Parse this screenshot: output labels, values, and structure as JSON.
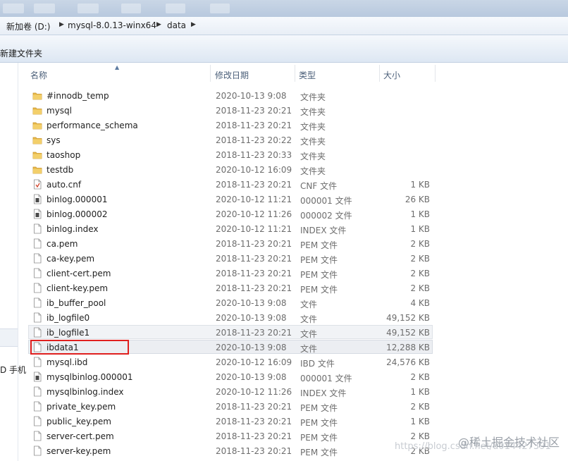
{
  "address": {
    "crumbs": [
      "新加卷 (D:)",
      "mysql-8.0.13-winx64",
      "data"
    ]
  },
  "toolbar": {
    "new_folder_label": "新建文件夹"
  },
  "left_pane": {
    "fragment_text": "D 手机"
  },
  "columns": {
    "name": "名称",
    "date": "修改日期",
    "type": "类型",
    "size": "大小"
  },
  "files": [
    {
      "name": "#innodb_temp",
      "date": "2020-10-13 9:08",
      "type": "文件夹",
      "size": "",
      "icon": "folder-icon"
    },
    {
      "name": "mysql",
      "date": "2018-11-23 20:21",
      "type": "文件夹",
      "size": "",
      "icon": "folder-icon"
    },
    {
      "name": "performance_schema",
      "date": "2018-11-23 20:21",
      "type": "文件夹",
      "size": "",
      "icon": "folder-icon"
    },
    {
      "name": "sys",
      "date": "2018-11-23 20:22",
      "type": "文件夹",
      "size": "",
      "icon": "folder-icon"
    },
    {
      "name": "taoshop",
      "date": "2018-11-23 20:33",
      "type": "文件夹",
      "size": "",
      "icon": "folder-icon"
    },
    {
      "name": "testdb",
      "date": "2020-10-12 16:09",
      "type": "文件夹",
      "size": "",
      "icon": "folder-icon"
    },
    {
      "name": "auto.cnf",
      "date": "2018-11-23 20:21",
      "type": "CNF 文件",
      "size": "1 KB",
      "icon": "config-file-icon"
    },
    {
      "name": "binlog.000001",
      "date": "2020-10-12 11:21",
      "type": "000001 文件",
      "size": "26 KB",
      "icon": "binary-file-icon"
    },
    {
      "name": "binlog.000002",
      "date": "2020-10-12 11:26",
      "type": "000002 文件",
      "size": "1 KB",
      "icon": "binary-file-icon"
    },
    {
      "name": "binlog.index",
      "date": "2020-10-12 11:21",
      "type": "INDEX 文件",
      "size": "1 KB",
      "icon": "file-icon"
    },
    {
      "name": "ca.pem",
      "date": "2018-11-23 20:21",
      "type": "PEM 文件",
      "size": "2 KB",
      "icon": "file-icon"
    },
    {
      "name": "ca-key.pem",
      "date": "2018-11-23 20:21",
      "type": "PEM 文件",
      "size": "2 KB",
      "icon": "file-icon"
    },
    {
      "name": "client-cert.pem",
      "date": "2018-11-23 20:21",
      "type": "PEM 文件",
      "size": "2 KB",
      "icon": "file-icon"
    },
    {
      "name": "client-key.pem",
      "date": "2018-11-23 20:21",
      "type": "PEM 文件",
      "size": "2 KB",
      "icon": "file-icon"
    },
    {
      "name": "ib_buffer_pool",
      "date": "2020-10-13 9:08",
      "type": "文件",
      "size": "4 KB",
      "icon": "file-icon"
    },
    {
      "name": "ib_logfile0",
      "date": "2020-10-13 9:08",
      "type": "文件",
      "size": "49,152 KB",
      "icon": "file-icon"
    },
    {
      "name": "ib_logfile1",
      "date": "2018-11-23 20:21",
      "type": "文件",
      "size": "49,152 KB",
      "icon": "file-icon"
    },
    {
      "name": "ibdata1",
      "date": "2020-10-13 9:08",
      "type": "文件",
      "size": "12,288 KB",
      "icon": "file-icon"
    },
    {
      "name": "mysql.ibd",
      "date": "2020-10-12 16:09",
      "type": "IBD 文件",
      "size": "24,576 KB",
      "icon": "file-icon"
    },
    {
      "name": "mysqlbinlog.000001",
      "date": "2020-10-13 9:08",
      "type": "000001 文件",
      "size": "2 KB",
      "icon": "binary-file-icon"
    },
    {
      "name": "mysqlbinlog.index",
      "date": "2020-10-12 11:26",
      "type": "INDEX 文件",
      "size": "1 KB",
      "icon": "file-icon"
    },
    {
      "name": "private_key.pem",
      "date": "2018-11-23 20:21",
      "type": "PEM 文件",
      "size": "2 KB",
      "icon": "file-icon"
    },
    {
      "name": "public_key.pem",
      "date": "2018-11-23 20:21",
      "type": "PEM 文件",
      "size": "1 KB",
      "icon": "file-icon"
    },
    {
      "name": "server-cert.pem",
      "date": "2018-11-23 20:21",
      "type": "PEM 文件",
      "size": "2 KB",
      "icon": "file-icon"
    },
    {
      "name": "server-key.pem",
      "date": "2018-11-23 20:21",
      "type": "PEM 文件",
      "size": "2 KB",
      "icon": "file-icon"
    }
  ],
  "highlighted_file": "ibdata1",
  "watermark": {
    "text": "@稀土掘金技术社区",
    "url": "https://blog.csdn.net/u014427391"
  },
  "colors": {
    "highlight": "#e0201f",
    "folder": "#e8b84a",
    "header_text": "#4c607a"
  }
}
